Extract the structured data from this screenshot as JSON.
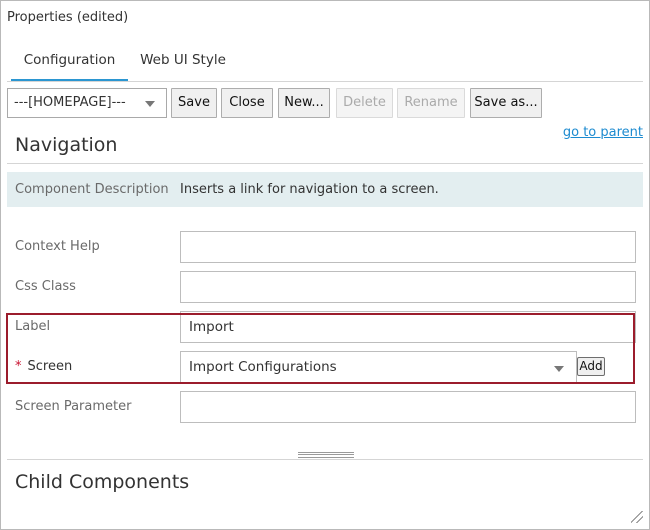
{
  "window": {
    "title": "Properties (edited)"
  },
  "tabs": [
    {
      "label": "Configuration",
      "active": true
    },
    {
      "label": "Web UI Style",
      "active": false
    }
  ],
  "toolbar": {
    "selector_value": "---[HOMEPAGE]---",
    "buttons": {
      "save": "Save",
      "close": "Close",
      "new": "New...",
      "delete": "Delete",
      "rename": "Rename",
      "save_as": "Save as..."
    }
  },
  "go_to_parent": "go to parent",
  "section_title": "Navigation",
  "component_description": {
    "label": "Component Description",
    "value": "Inserts a link for navigation to a screen."
  },
  "fields": {
    "context_help": {
      "label": "Context Help",
      "value": ""
    },
    "css_class": {
      "label": "Css Class",
      "value": ""
    },
    "label": {
      "label": "Label",
      "value": "Import"
    },
    "screen": {
      "required_marker": "*",
      "label": "Screen",
      "value": "Import Configurations",
      "add_label": "Add"
    },
    "screen_parameter": {
      "label": "Screen Parameter",
      "value": ""
    }
  },
  "child_components_title": "Child Components",
  "colors": {
    "accent": "#2b96d1",
    "highlight_border": "#9b1c2c",
    "description_band": "#e3eef0",
    "link": "#1d8bd0",
    "required": "#c8102e"
  }
}
